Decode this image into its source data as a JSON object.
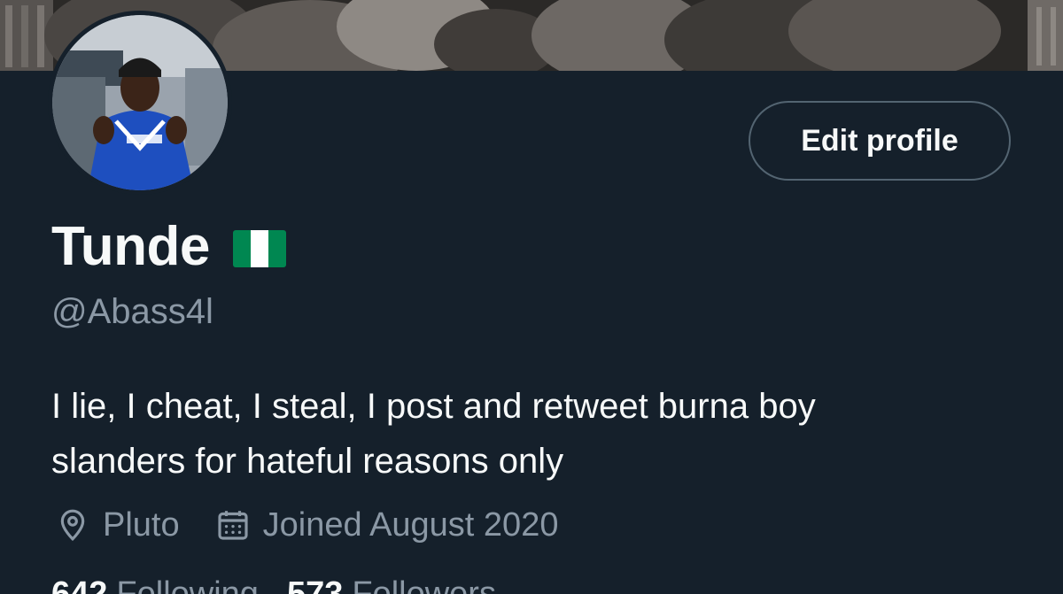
{
  "profile": {
    "name": "Tunde",
    "handle": "@Abass4l",
    "bio_line_1": "I lie, I cheat, I steal, I post and retweet burna boy",
    "bio_line_2": "slanders for hateful reasons only",
    "location": "Pluto",
    "joined": "Joined August 2020",
    "flag_colors": [
      "#008751",
      "#ffffff",
      "#008751"
    ]
  },
  "actions": {
    "edit_profile_label": "Edit profile"
  },
  "stats": {
    "following_count": "642",
    "following_label": "Following",
    "followers_count": "573",
    "followers_label": "Followers"
  },
  "icons": {
    "location": "location-pin-icon",
    "joined": "calendar-icon"
  },
  "colors": {
    "background": "#15202b",
    "primary_text": "#f7f9f9",
    "secondary_text": "#8b98a5",
    "button_border": "#536471"
  }
}
